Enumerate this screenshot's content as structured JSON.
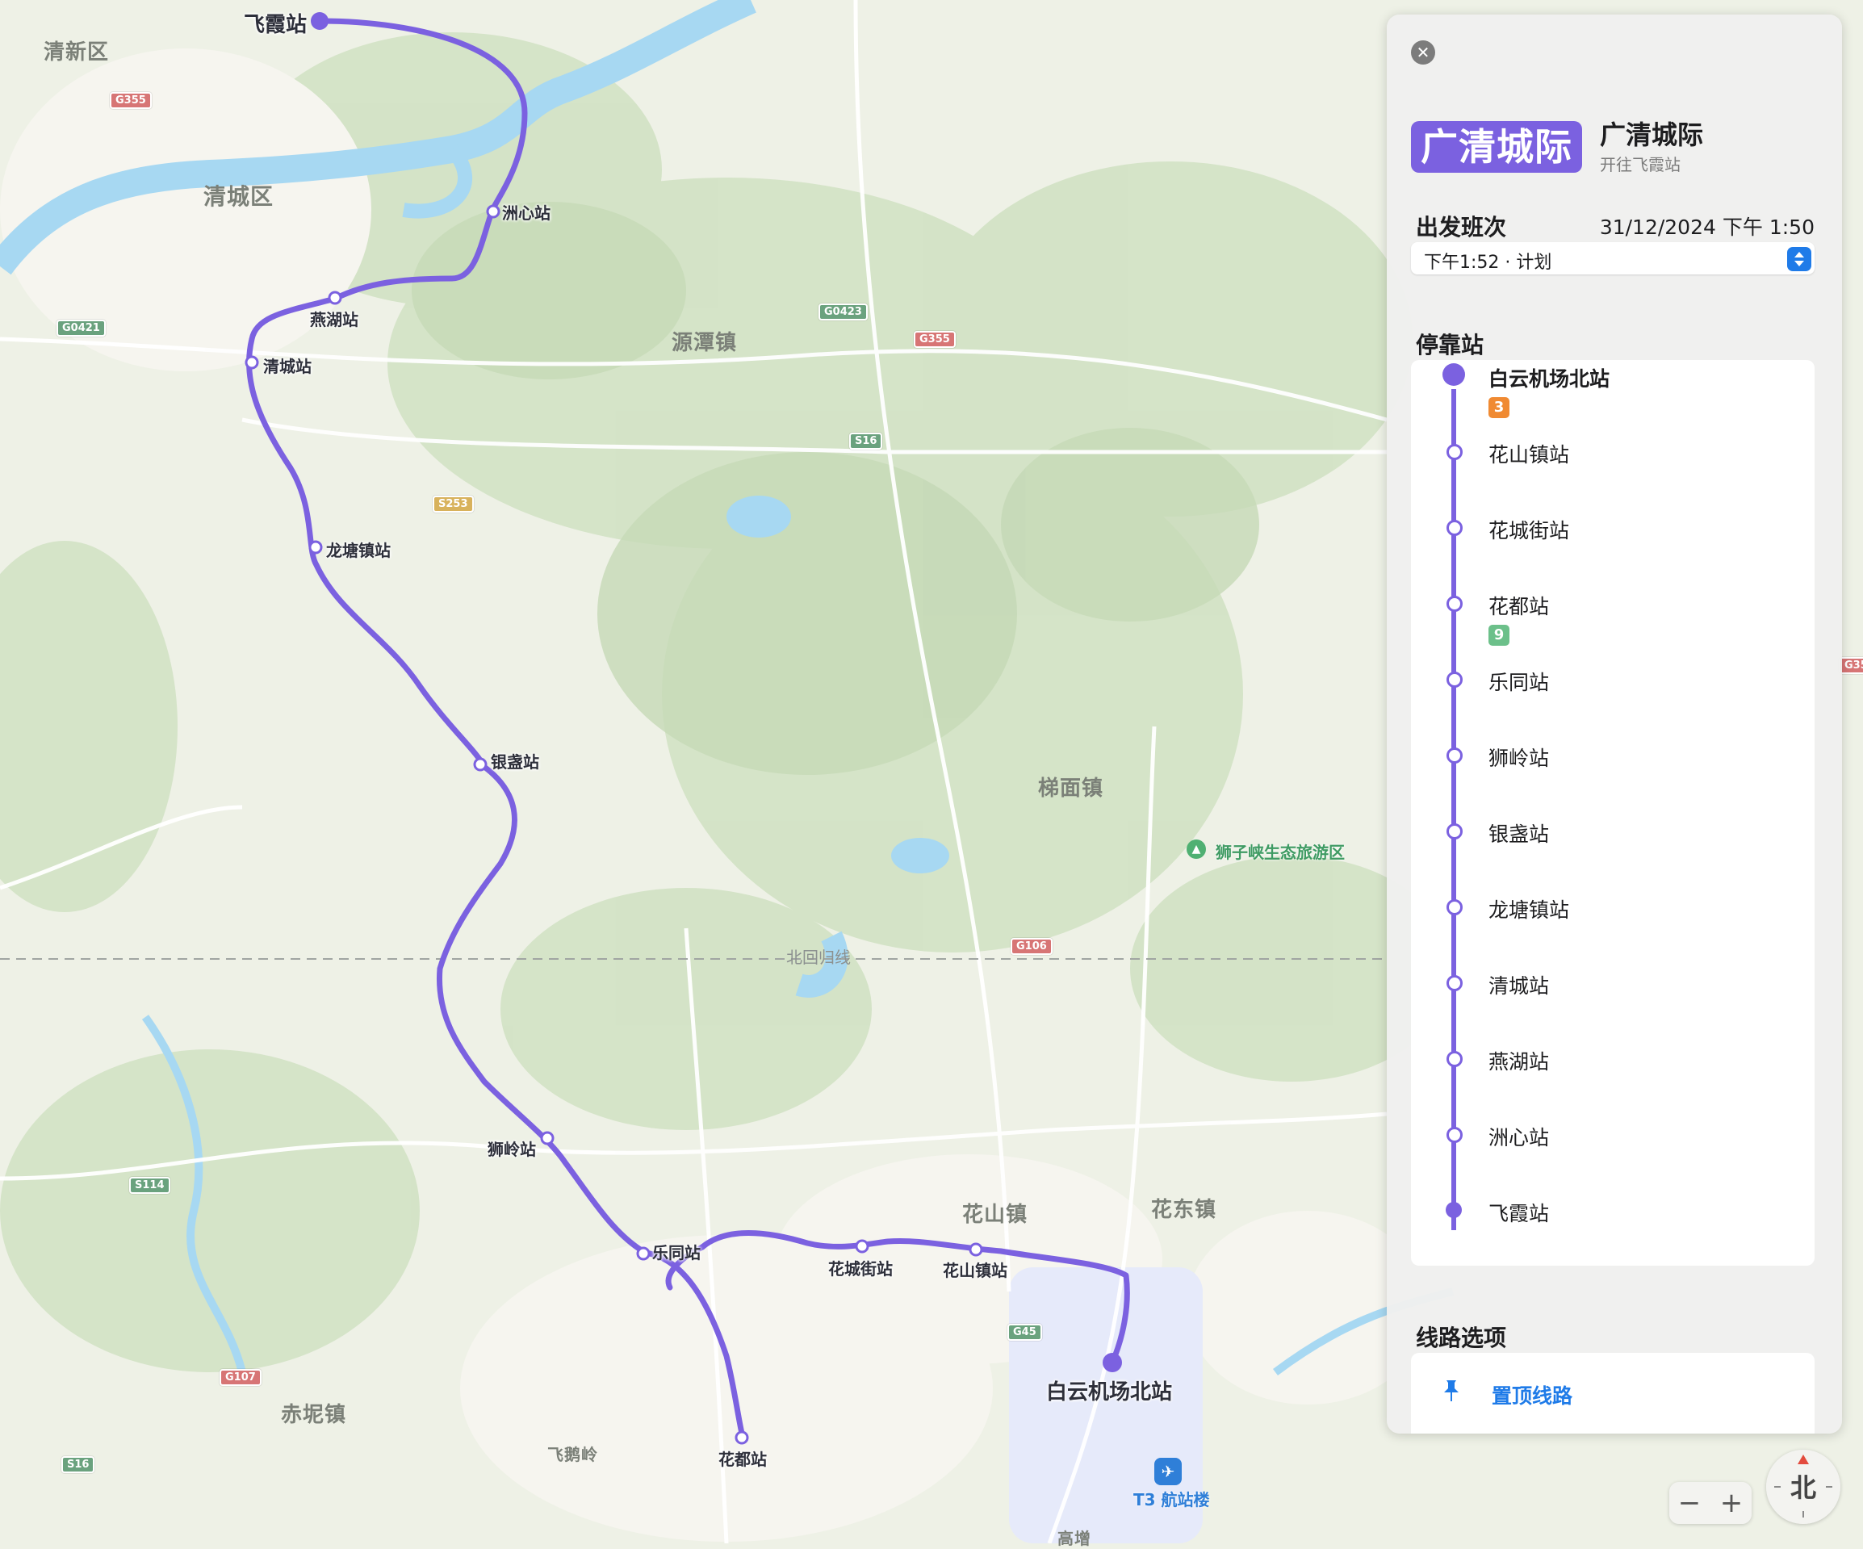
{
  "map": {
    "colors": {
      "route": "#7b61e0",
      "land": "#eef1e6",
      "forest": "#cfe0c2",
      "water": "#a7d8f2",
      "urban": "#f7f6f1",
      "airport_zone": "#e8ecfa"
    },
    "place_labels": [
      "清新区",
      "清城区",
      "源潭镇",
      "梯面镇",
      "花山镇",
      "花东镇",
      "赤坭镇",
      "飞鹅岭",
      "高增"
    ],
    "road_shields": [
      "G355",
      "G0421",
      "G0423",
      "G355",
      "S16",
      "S253",
      "G106",
      "S114",
      "G107",
      "S16",
      "G45",
      "G35"
    ],
    "tropic_label": "北回归线",
    "poi": {
      "name": "狮子峡生态旅游区",
      "icon": "park-icon"
    },
    "airport": {
      "name": "T3 航站楼",
      "icon": "airplane-icon"
    },
    "route_stations": [
      "飞霞站",
      "洲心站",
      "燕湖站",
      "清城站",
      "龙塘镇站",
      "银盏站",
      "狮岭站",
      "乐同站",
      "花城街站",
      "花山镇站",
      "白云机场北站",
      "花都站"
    ]
  },
  "panel": {
    "close_icon": "close-icon",
    "line_badge": "广清城际",
    "line_name": "广清城际",
    "direction": "开往飞霞站",
    "departure": {
      "title": "出发班次",
      "date": "31/12/2024",
      "time": "下午 1:50",
      "selected": "下午1:52 · 计划"
    },
    "stops_title": "停靠站",
    "stops": [
      {
        "name": "白云机场北站",
        "transfer": "3",
        "transfer_color": "#f08a32"
      },
      {
        "name": "花山镇站"
      },
      {
        "name": "花城街站"
      },
      {
        "name": "花都站",
        "transfer": "9",
        "transfer_color": "#6cc08a"
      },
      {
        "name": "乐同站"
      },
      {
        "name": "狮岭站"
      },
      {
        "name": "银盏站"
      },
      {
        "name": "龙塘镇站"
      },
      {
        "name": "清城站"
      },
      {
        "name": "燕湖站"
      },
      {
        "name": "洲心站"
      },
      {
        "name": "飞霞站"
      }
    ],
    "options_title": "线路选项",
    "pin_label": "置顶线路",
    "pin_icon": "pin-icon"
  },
  "controls": {
    "zoom_out": "−",
    "zoom_in": "+",
    "compass_label": "北"
  }
}
